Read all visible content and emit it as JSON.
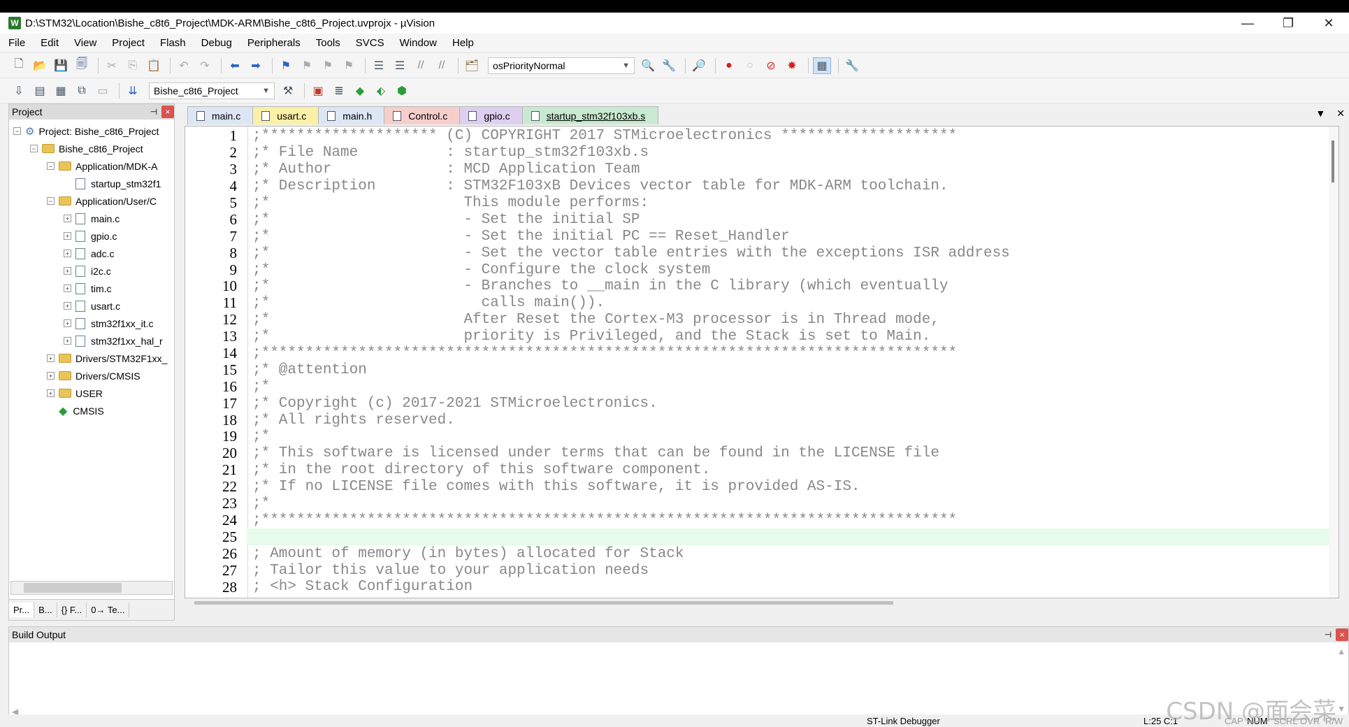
{
  "window": {
    "title": "D:\\STM32\\Location\\Bishe_c8t6_Project\\MDK-ARM\\Bishe_c8t6_Project.uvprojx - µVision",
    "controls": [
      "—",
      "❐",
      "✕"
    ]
  },
  "menu": [
    "File",
    "Edit",
    "View",
    "Project",
    "Flash",
    "Debug",
    "Peripherals",
    "Tools",
    "SVCS",
    "Window",
    "Help"
  ],
  "toolbar1": {
    "combo": "osPriorityNormal"
  },
  "toolbar2": {
    "target": "Bishe_c8t6_Project"
  },
  "project_panel": {
    "title": "Project",
    "pin": "⊣",
    "close": "×",
    "tree": [
      {
        "label": "Project: Bishe_c8t6_Project",
        "level": 0,
        "expander": "−",
        "kind": "project"
      },
      {
        "label": "Bishe_c8t6_Project",
        "level": 1,
        "expander": "−",
        "kind": "target"
      },
      {
        "label": "Application/MDK-A",
        "level": 2,
        "expander": "−",
        "kind": "folder"
      },
      {
        "label": "startup_stm32f1",
        "level": 3,
        "expander": "",
        "kind": "file"
      },
      {
        "label": "Application/User/C",
        "level": 2,
        "expander": "−",
        "kind": "folder"
      },
      {
        "label": "main.c",
        "level": 3,
        "expander": "+",
        "kind": "file"
      },
      {
        "label": "gpio.c",
        "level": 3,
        "expander": "+",
        "kind": "file"
      },
      {
        "label": "adc.c",
        "level": 3,
        "expander": "+",
        "kind": "file"
      },
      {
        "label": "i2c.c",
        "level": 3,
        "expander": "+",
        "kind": "file"
      },
      {
        "label": "tim.c",
        "level": 3,
        "expander": "+",
        "kind": "file"
      },
      {
        "label": "usart.c",
        "level": 3,
        "expander": "+",
        "kind": "file"
      },
      {
        "label": "stm32f1xx_it.c",
        "level": 3,
        "expander": "+",
        "kind": "file"
      },
      {
        "label": "stm32f1xx_hal_r",
        "level": 3,
        "expander": "+",
        "kind": "file"
      },
      {
        "label": "Drivers/STM32F1xx_",
        "level": 2,
        "expander": "+",
        "kind": "folder"
      },
      {
        "label": "Drivers/CMSIS",
        "level": 2,
        "expander": "+",
        "kind": "folder"
      },
      {
        "label": "USER",
        "level": 2,
        "expander": "+",
        "kind": "folder"
      },
      {
        "label": "CMSIS",
        "level": 2,
        "expander": "",
        "kind": "diamond"
      }
    ],
    "tabs": [
      "Pr...",
      "B...",
      "{} F...",
      "0→ Te..."
    ]
  },
  "editor_tabs": [
    {
      "label": "main.c",
      "color": "#dde6f4"
    },
    {
      "label": "usart.c",
      "color": "#fbf0a8"
    },
    {
      "label": "main.h",
      "color": "#dde6f4"
    },
    {
      "label": "Control.c",
      "color": "#f6cfcc"
    },
    {
      "label": "gpio.c",
      "color": "#dccfef"
    },
    {
      "label": "startup_stm32f103xb.s",
      "color": "#c9ead0"
    }
  ],
  "code_lines": [
    {
      "n": "1",
      "t": ";******************** (C) COPYRIGHT 2017 STMicroelectronics ********************"
    },
    {
      "n": "2",
      "t": ";* File Name          : startup_stm32f103xb.s"
    },
    {
      "n": "3",
      "t": ";* Author             : MCD Application Team"
    },
    {
      "n": "4",
      "t": ";* Description        : STM32F103xB Devices vector table for MDK-ARM toolchain."
    },
    {
      "n": "5",
      "t": ";*                      This module performs:"
    },
    {
      "n": "6",
      "t": ";*                      - Set the initial SP"
    },
    {
      "n": "7",
      "t": ";*                      - Set the initial PC == Reset_Handler"
    },
    {
      "n": "8",
      "t": ";*                      - Set the vector table entries with the exceptions ISR address"
    },
    {
      "n": "9",
      "t": ";*                      - Configure the clock system"
    },
    {
      "n": "10",
      "t": ";*                      - Branches to __main in the C library (which eventually"
    },
    {
      "n": "11",
      "t": ";*                        calls main())."
    },
    {
      "n": "12",
      "t": ";*                      After Reset the Cortex-M3 processor is in Thread mode,"
    },
    {
      "n": "13",
      "t": ";*                      priority is Privileged, and the Stack is set to Main."
    },
    {
      "n": "14",
      "t": ";*******************************************************************************"
    },
    {
      "n": "15",
      "t": ";* @attention"
    },
    {
      "n": "16",
      "t": ";*"
    },
    {
      "n": "17",
      "t": ";* Copyright (c) 2017-2021 STMicroelectronics."
    },
    {
      "n": "18",
      "t": ";* All rights reserved."
    },
    {
      "n": "19",
      "t": ";*"
    },
    {
      "n": "20",
      "t": ";* This software is licensed under terms that can be found in the LICENSE file"
    },
    {
      "n": "21",
      "t": ";* in the root directory of this software component."
    },
    {
      "n": "22",
      "t": ";* If no LICENSE file comes with this software, it is provided AS-IS."
    },
    {
      "n": "23",
      "t": ";*"
    },
    {
      "n": "24",
      "t": ";*******************************************************************************"
    },
    {
      "n": "25",
      "t": ""
    },
    {
      "n": "26",
      "t": "; Amount of memory (in bytes) allocated for Stack"
    },
    {
      "n": "27",
      "t": "; Tailor this value to your application needs"
    },
    {
      "n": "28",
      "t": "; <h> Stack Configuration"
    }
  ],
  "highlighted_line": "25",
  "build_output": {
    "title": "Build Output"
  },
  "status": {
    "debugger": "ST-Link Debugger",
    "position": "L:25 C:1",
    "indicators": [
      "CAP",
      "NUM",
      "SCRL",
      "OVR",
      "R/W"
    ]
  },
  "watermark": "CSDN @面会菜"
}
